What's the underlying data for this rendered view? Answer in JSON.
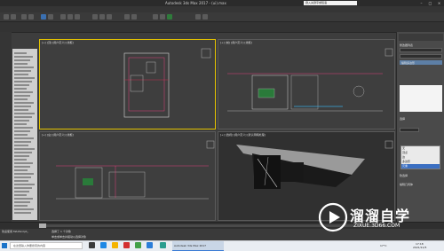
{
  "window": {
    "title": "Autodesk 3ds Max 2017 - (ui).max",
    "search_placeholder": "键入关键字或短语"
  },
  "viewports": {
    "top": {
      "label": "[+] [顶] [用户定义] [线框]"
    },
    "front": {
      "label": "[+] [前] [用户定义] [线框]"
    },
    "left": {
      "label": "[+] [左] [用户定义] [线框]"
    },
    "perspective": {
      "label": "[+] [透视] [用户定义] [默认明暗处理]"
    }
  },
  "command_panel": {
    "section_title": "修改器列表",
    "modifier_item": "编辑多边形",
    "rollout_1": "选择",
    "rollout_2": "软选择",
    "rollout_3": "编辑几何体",
    "dropdown_options": [
      "无",
      "顶点",
      "边",
      "多边形",
      "元素"
    ],
    "highlighted_option": "元素"
  },
  "status": {
    "selected": "选择了 1 个对象",
    "prompt": "单击或单击并拖动以选择对象",
    "welcome": "欢迎使用 MAXScript。"
  },
  "taskbar": {
    "search_placeholder": "在这里输入你要搜索的内容",
    "active_app": "Autodesk 3ds Max 2017",
    "time": "17:18",
    "date": "2021/11/5",
    "temp": "17°C"
  },
  "watermark": {
    "name": "溜溜自学",
    "url": "ZIXUE.3D66.COM"
  },
  "colors": {
    "accent": "#e5c300",
    "taskbar": "#e9edf2"
  }
}
